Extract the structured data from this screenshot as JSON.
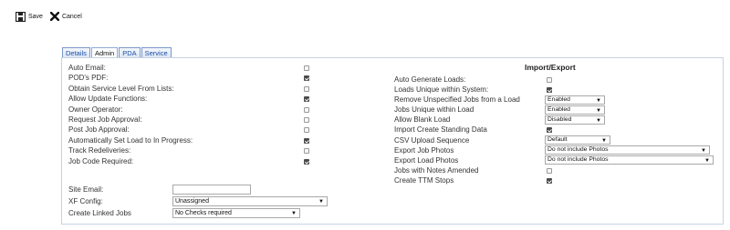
{
  "toolbar": {
    "save_label": "Save",
    "cancel_label": "Cancel"
  },
  "tabs": [
    {
      "label": "Details",
      "active": false
    },
    {
      "label": "Admin",
      "active": true
    },
    {
      "label": "PDA",
      "active": false
    },
    {
      "label": "Service",
      "active": false
    }
  ],
  "left_fields": [
    {
      "label": "Auto Email:",
      "checked": false
    },
    {
      "label": "POD's PDF:",
      "checked": true
    },
    {
      "label": "Obtain Service Level From Lists:",
      "checked": false
    },
    {
      "label": "Allow Update Functions:",
      "checked": true
    },
    {
      "label": "Owner Operator:",
      "checked": false
    },
    {
      "label": "Request Job Approval:",
      "checked": false
    },
    {
      "label": "Post Job Approval:",
      "checked": false
    },
    {
      "label": "Automatically Set Load to In Progress:",
      "checked": true
    },
    {
      "label": "Track Redeliveries:",
      "checked": false
    },
    {
      "label": "Job Code Required:",
      "checked": true
    }
  ],
  "site_email": {
    "label": "Site Email:",
    "value": ""
  },
  "xf_config": {
    "label": "XF Config:",
    "value": "Unassigned"
  },
  "create_linked_jobs": {
    "label": "Create Linked Jobs",
    "value": "No Checks required"
  },
  "import_export": {
    "title": "Import/Export",
    "rows": [
      {
        "label": "Auto Generate Loads:",
        "type": "checkbox",
        "checked": false
      },
      {
        "label": "Loads Unique within System:",
        "type": "checkbox",
        "checked": true
      },
      {
        "label": "Remove Unspecified Jobs from a Load",
        "type": "select",
        "value": "Enabled"
      },
      {
        "label": "Jobs Unique within Load",
        "type": "select",
        "value": "Enabled"
      },
      {
        "label": "Allow Blank Load",
        "type": "select",
        "value": "Disabled"
      },
      {
        "label": "Import Create Standing Data",
        "type": "checkbox",
        "checked": true
      },
      {
        "label": "CSV Upload Sequence",
        "type": "select",
        "value": "Default"
      },
      {
        "label": "Export Job Photos",
        "type": "select",
        "value": "Do not include Photos"
      },
      {
        "label": "Export Load Photos",
        "type": "select",
        "value": "Do not include Photos"
      },
      {
        "label": "Jobs with Notes Amended",
        "type": "checkbox",
        "checked": false
      },
      {
        "label": "Create TTM Stops",
        "type": "checkbox",
        "checked": true
      }
    ]
  }
}
